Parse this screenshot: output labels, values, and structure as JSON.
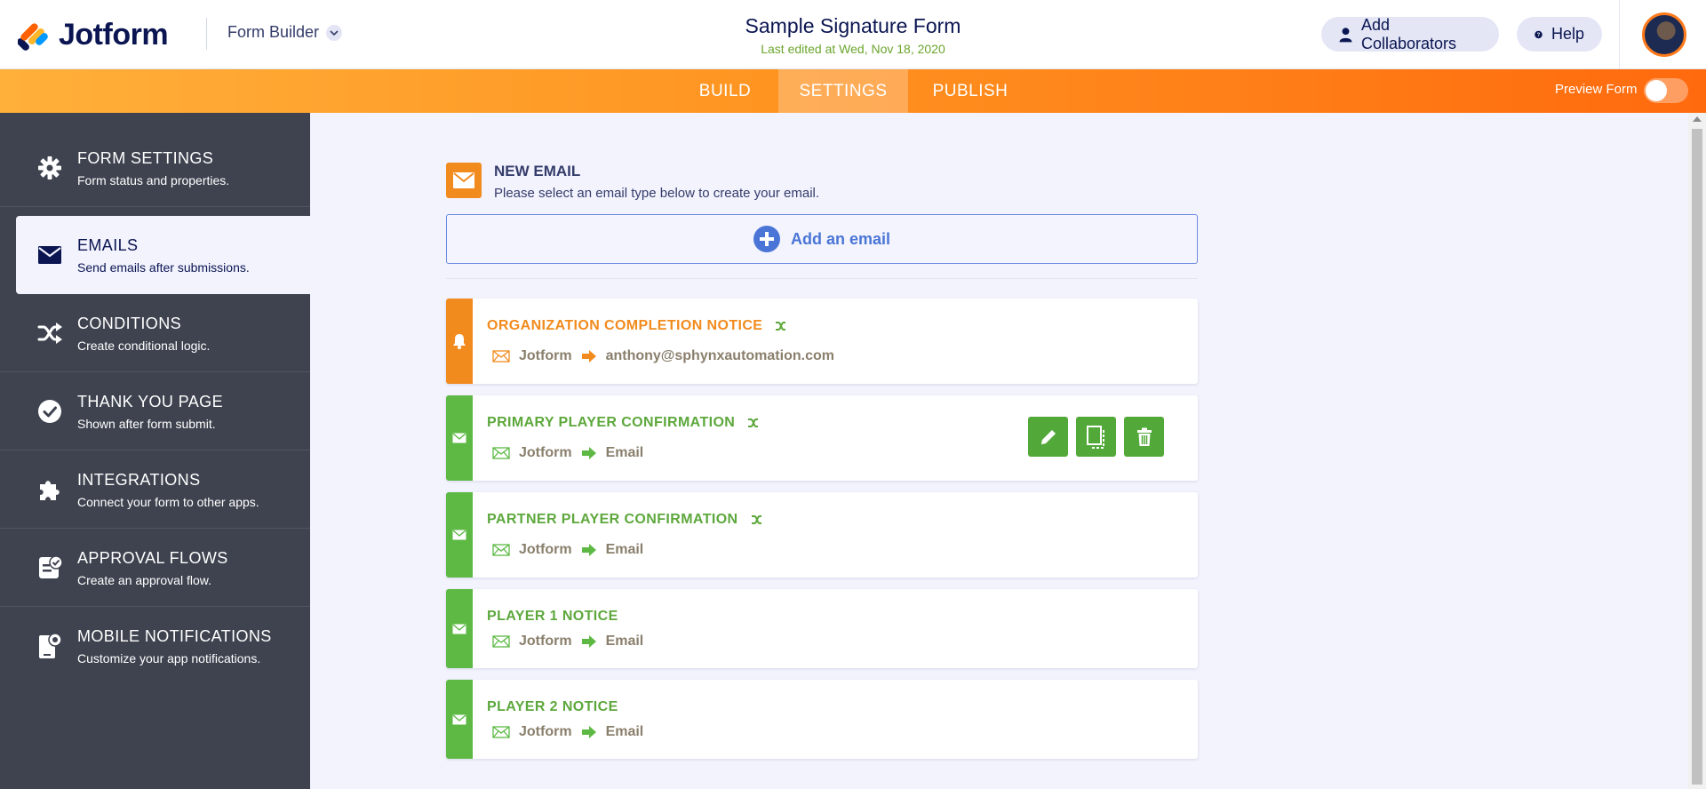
{
  "header": {
    "logo_text": "Jotform",
    "builder_label": "Form Builder",
    "form_title": "Sample Signature Form",
    "last_edited": "Last edited at Wed, Nov 18, 2020",
    "add_collaborators": "Add Collaborators",
    "help": "Help"
  },
  "nav": {
    "tabs": [
      {
        "label": "BUILD"
      },
      {
        "label": "SETTINGS",
        "active": true
      },
      {
        "label": "PUBLISH"
      }
    ],
    "preview_label": "Preview Form",
    "preview_on": false
  },
  "sidebar": {
    "items": [
      {
        "title": "FORM SETTINGS",
        "desc": "Form status and properties.",
        "icon": "gear-icon"
      },
      {
        "title": "EMAILS",
        "desc": "Send emails after submissions.",
        "icon": "envelope-icon",
        "active": true
      },
      {
        "title": "CONDITIONS",
        "desc": "Create conditional logic.",
        "icon": "shuffle-icon"
      },
      {
        "title": "THANK YOU PAGE",
        "desc": "Shown after form submit.",
        "icon": "check-circle-icon"
      },
      {
        "title": "INTEGRATIONS",
        "desc": "Connect your form to other apps.",
        "icon": "puzzle-icon"
      },
      {
        "title": "APPROVAL FLOWS",
        "desc": "Create an approval flow.",
        "icon": "approval-icon"
      },
      {
        "title": "MOBILE NOTIFICATIONS",
        "desc": "Customize your app notifications.",
        "icon": "mobile-notification-icon"
      }
    ]
  },
  "emails": {
    "new_email_title": "NEW EMAIL",
    "new_email_desc": "Please select an email type below to create your email.",
    "add_email_label": "Add an email",
    "list": [
      {
        "title": "ORGANIZATION COMPLETION NOTICE",
        "from": "Jotform",
        "to": "anthony@sphynxautomation.com",
        "type": "autoresponder",
        "color": "#f28b1e",
        "has_condition": true
      },
      {
        "title": "PRIMARY PLAYER CONFIRMATION",
        "from": "Jotform",
        "to": "Email",
        "type": "notification",
        "color": "#5db944",
        "has_condition": true,
        "show_actions": true
      },
      {
        "title": "PARTNER PLAYER CONFIRMATION",
        "from": "Jotform",
        "to": "Email",
        "type": "notification",
        "color": "#5db944",
        "has_condition": true
      },
      {
        "title": "PLAYER 1 NOTICE",
        "from": "Jotform",
        "to": "Email",
        "type": "notification",
        "color": "#5db944",
        "has_condition": false
      },
      {
        "title": "PLAYER 2 NOTICE",
        "from": "Jotform",
        "to": "Email",
        "type": "notification",
        "color": "#5db944",
        "has_condition": false
      }
    ]
  }
}
